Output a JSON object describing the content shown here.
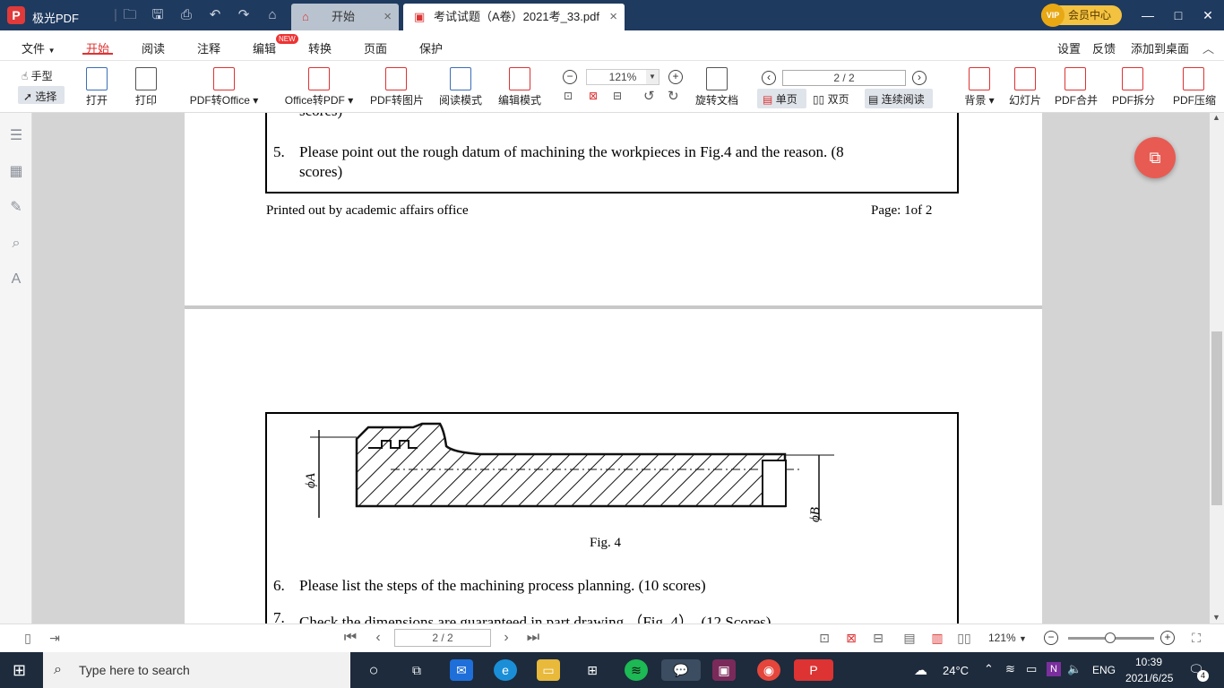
{
  "app": {
    "name": "极光PDF"
  },
  "tabs": [
    {
      "label": "开始"
    },
    {
      "label": "考试试题（A卷）2021考_33.pdf"
    }
  ],
  "vip": {
    "label": "会员中心",
    "badge": "VIP"
  },
  "menus": {
    "file": "文件",
    "start": "开始",
    "read": "阅读",
    "annotate": "注释",
    "edit": "编辑",
    "new_badge": "NEW",
    "convert": "转换",
    "page": "页面",
    "protect": "保护",
    "settings": "设置",
    "feedback": "反馈",
    "add_desktop": "添加到桌面"
  },
  "toolbar": {
    "hand": "手型",
    "select": "选择",
    "open": "打开",
    "print": "打印",
    "pdf_to_office": "PDF转Office",
    "office_to_pdf": "Office转PDF",
    "pdf_to_image": "PDF转图片",
    "read_mode": "阅读模式",
    "edit_mode": "编辑模式",
    "zoom": "121%",
    "rotate": "旋转文档",
    "page": "2 / 2",
    "single": "单页",
    "double": "双页",
    "continuous": "连续阅读",
    "background": "背景",
    "slideshow": "幻灯片",
    "merge": "PDF合并",
    "split": "PDF拆分",
    "compress": "PDF压缩"
  },
  "document": {
    "top_fragment": "scores)",
    "q5_num": "5.",
    "q5_line1": "Please point out the rough datum of machining the workpieces in Fig.4 and the reason. (8",
    "q5_line2": "scores)",
    "footer_left": "Printed out by academic affairs office",
    "footer_right": "Page:  1of  2",
    "fig_caption": "Fig. 4",
    "label_phiA": "ϕA",
    "label_phiB": "ϕB",
    "q6_num": "6.",
    "q6_text": "Please list the steps of the machining process planning. (10 scores)",
    "q7_num": "7.",
    "q7_text": "Check the dimensions are guaranteed in part drawing （Fig. 4）. (12 Scores)"
  },
  "status": {
    "page": "2 / 2",
    "zoom": "121%"
  },
  "taskbar": {
    "search_placeholder": "Type here to search",
    "weather": "24°C",
    "lang": "ENG",
    "time": "10:39",
    "date": "2021/6/25",
    "notifications": "4"
  },
  "colors": {
    "accent": "#d33333",
    "titlebar": "#1f3a5f",
    "taskbar": "#1d2b3c",
    "canvas": "#d4d4d4"
  }
}
